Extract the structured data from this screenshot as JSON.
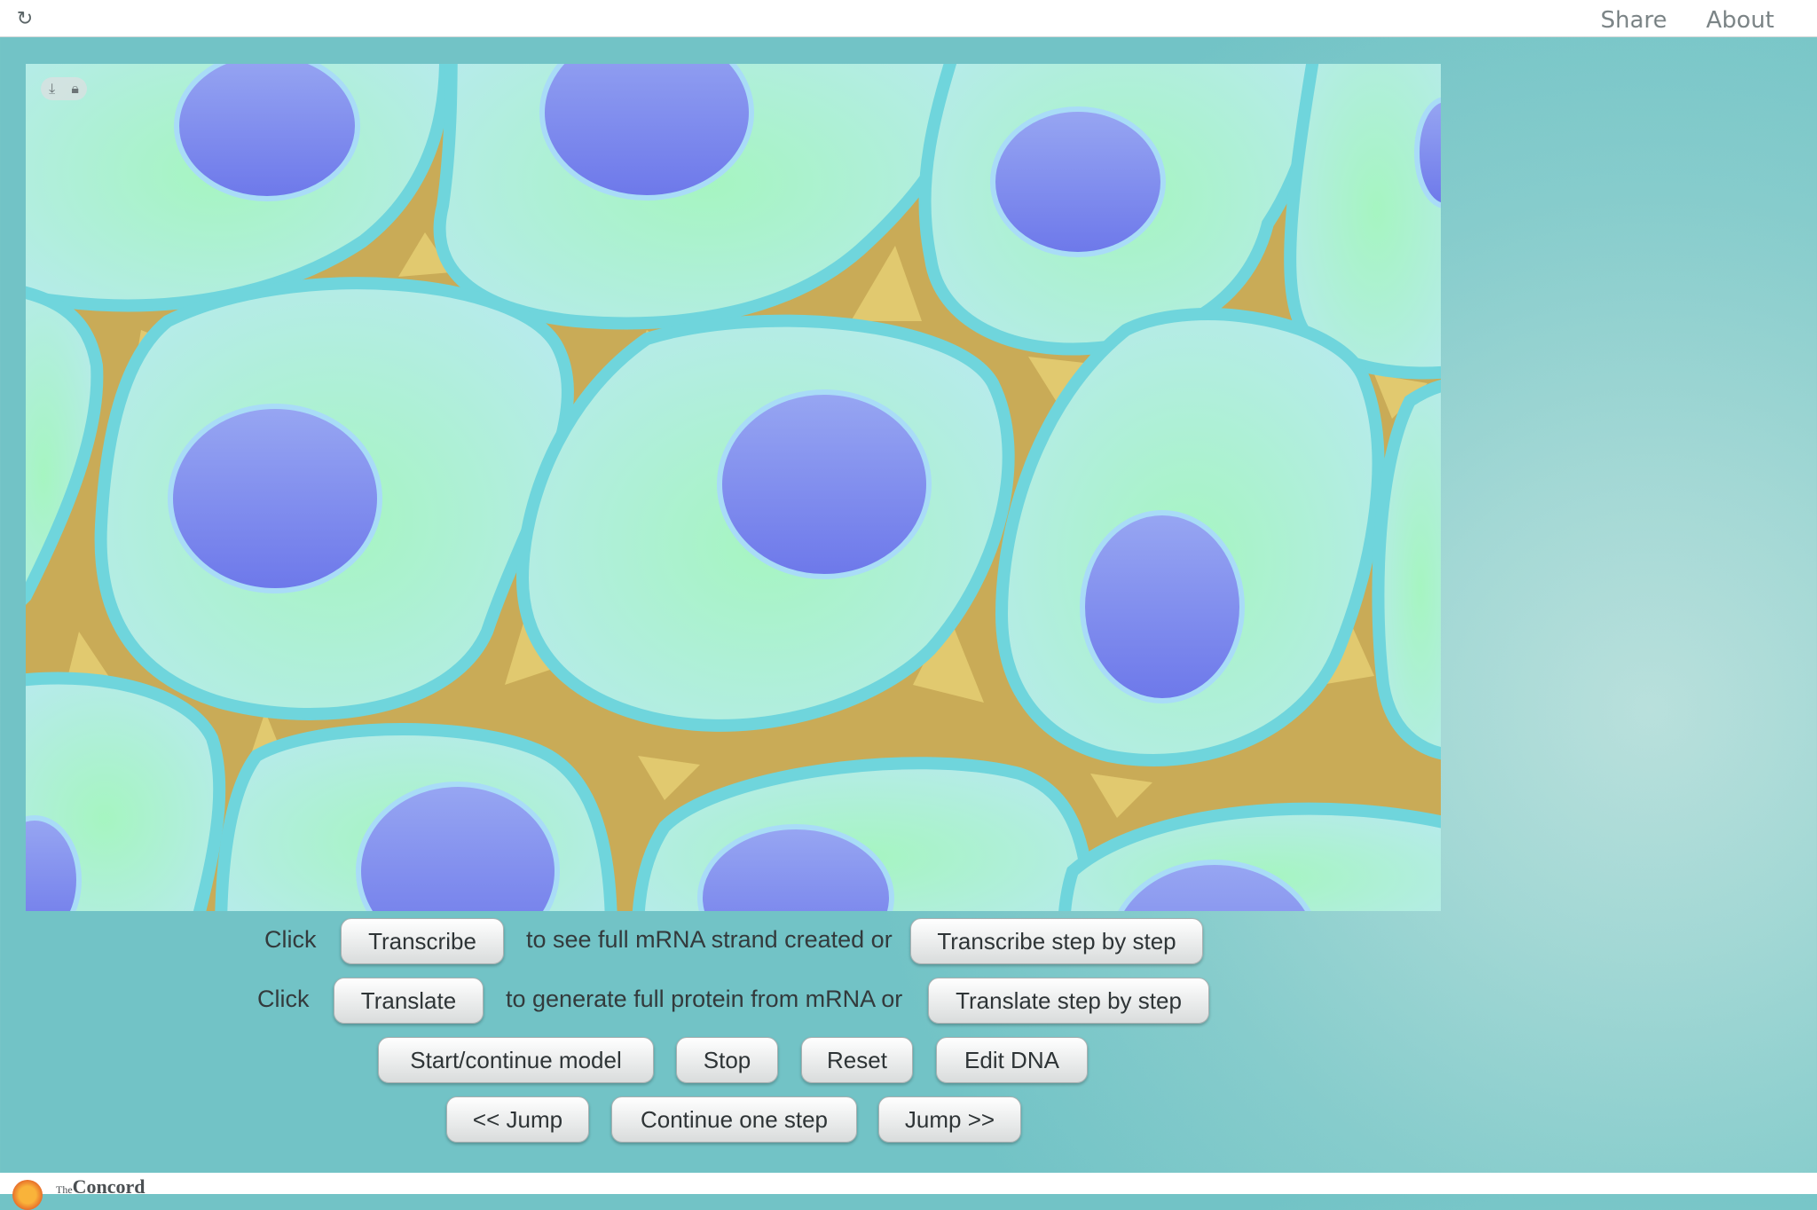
{
  "header": {
    "reload_icon": "reload-icon",
    "share_label": "Share",
    "about_label": "About"
  },
  "model": {
    "description_icon_download": "download-icon",
    "description_icon_lock": "lock-icon",
    "colors": {
      "cytoplasm_light": "#b6ebea",
      "cytoplasm_green": "#a6f5c1",
      "membrane": "#6fd5dc",
      "extracellular": "#c9ab57",
      "extracellular_light": "#e1c96f",
      "nucleus": "#7b86ef",
      "nucleus_ring": "#a9dcf7"
    }
  },
  "controls": {
    "row1": {
      "prefix": "Click",
      "button": "Transcribe",
      "middle": "to see full mRNA strand created or",
      "button2": "Transcribe step by step"
    },
    "row2": {
      "prefix": "Click",
      "button": "Translate",
      "middle": "to generate full protein from mRNA or",
      "button2": "Translate step by step"
    },
    "row3": {
      "start": "Start/continue model",
      "stop": "Stop",
      "reset": "Reset",
      "edit": "Edit DNA"
    },
    "row4": {
      "jump_back": "<< Jump",
      "step": "Continue one step",
      "jump_fwd": "Jump >>"
    }
  },
  "footer": {
    "logo_icon": "concord-sun-icon",
    "brand_small": "The",
    "brand": "Concord"
  }
}
